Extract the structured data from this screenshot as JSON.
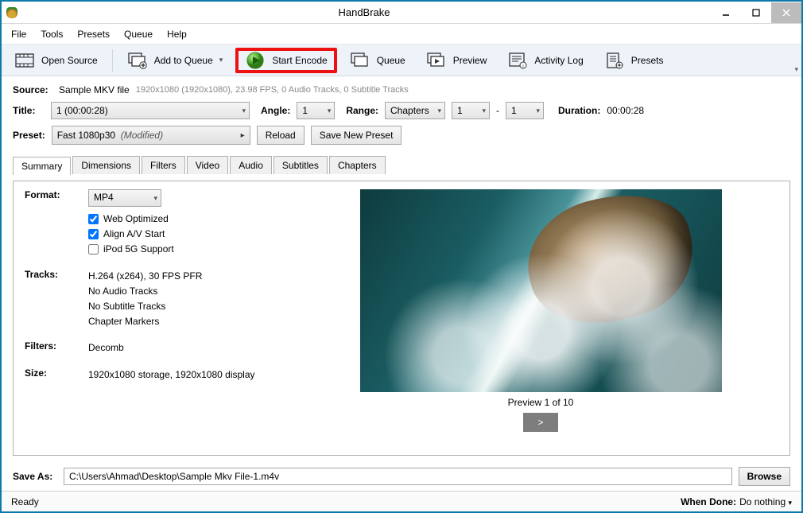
{
  "title": "HandBrake",
  "menu": {
    "file": "File",
    "tools": "Tools",
    "presets": "Presets",
    "queue": "Queue",
    "help": "Help"
  },
  "toolbar": {
    "open_source": "Open Source",
    "add_queue": "Add to Queue",
    "start_encode": "Start Encode",
    "queue": "Queue",
    "preview": "Preview",
    "activity_log": "Activity Log",
    "presets": "Presets"
  },
  "source": {
    "label": "Source:",
    "name": "Sample MKV file",
    "meta": "1920x1080 (1920x1080), 23.98 FPS, 0 Audio Tracks, 0 Subtitle Tracks"
  },
  "title_row": {
    "title_label": "Title:",
    "title_value": "1 (00:00:28)",
    "angle_label": "Angle:",
    "angle_value": "1",
    "range_label": "Range:",
    "range_type": "Chapters",
    "range_from": "1",
    "range_dash": "-",
    "range_to": "1",
    "duration_label": "Duration:",
    "duration_value": "00:00:28"
  },
  "preset_row": {
    "preset_label": "Preset:",
    "preset_name": "Fast 1080p30",
    "preset_mod": "(Modified)",
    "reload": "Reload",
    "save_new": "Save New Preset"
  },
  "tabs": {
    "summary": "Summary",
    "dimensions": "Dimensions",
    "filters": "Filters",
    "video": "Video",
    "audio": "Audio",
    "subtitles": "Subtitles",
    "chapters": "Chapters"
  },
  "summary": {
    "format_label": "Format:",
    "format_value": "MP4",
    "chk_web": "Web Optimized",
    "chk_align": "Align A/V Start",
    "chk_ipod": "iPod 5G Support",
    "tracks_label": "Tracks:",
    "tracks_lines": [
      "H.264 (x264), 30 FPS PFR",
      "No Audio Tracks",
      "No Subtitle Tracks",
      "Chapter Markers"
    ],
    "filters_label": "Filters:",
    "filters_value": "Decomb",
    "size_label": "Size:",
    "size_value": "1920x1080 storage, 1920x1080 display"
  },
  "preview": {
    "label": "Preview 1 of 10",
    "next": ">"
  },
  "saveas": {
    "label": "Save As:",
    "path": "C:\\Users\\Ahmad\\Desktop\\Sample Mkv File-1.m4v",
    "browse": "Browse"
  },
  "status": {
    "ready": "Ready",
    "when_done_label": "When Done:",
    "when_done_value": "Do nothing"
  }
}
